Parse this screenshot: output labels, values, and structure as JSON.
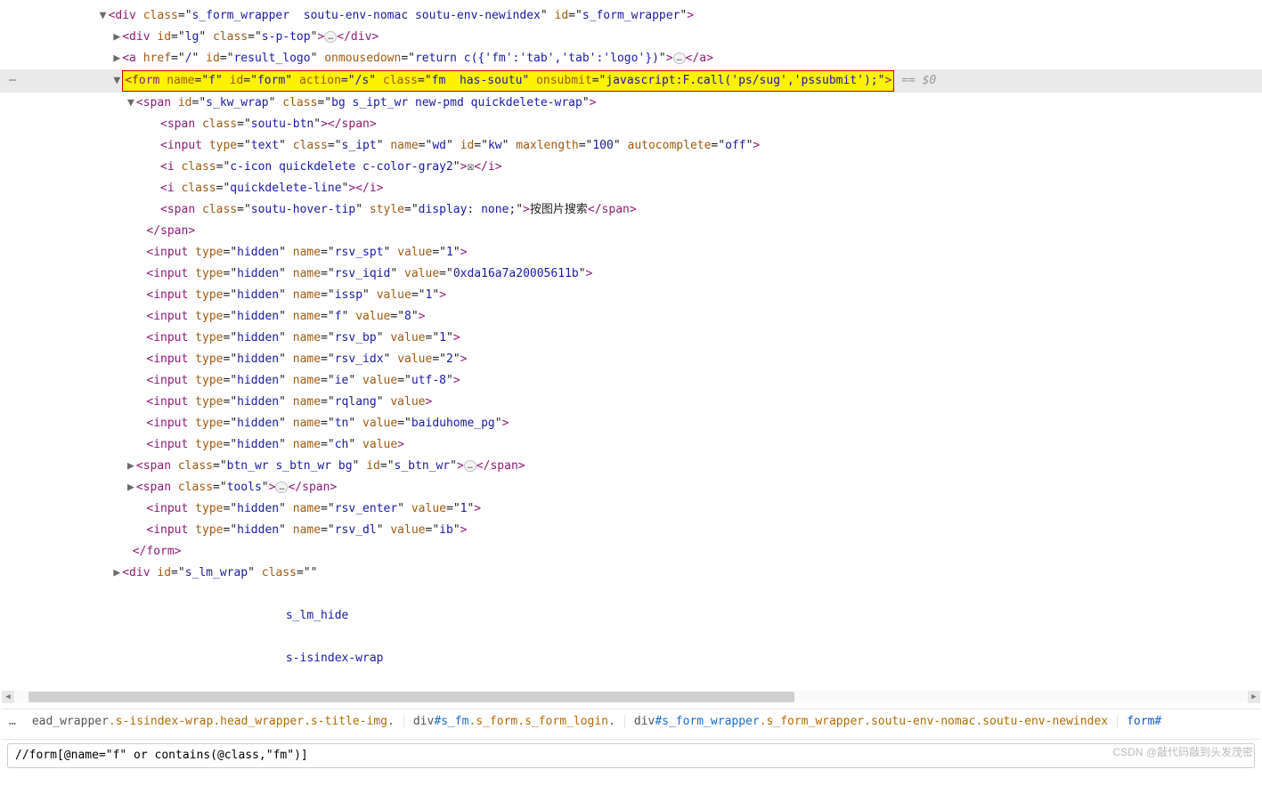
{
  "gutterDots": "…",
  "selectedAfter": " == $0",
  "searchValue": "//form[@name=\"f\" or contains(@class,\"fm\")]",
  "watermark": "CSDN @敲代码敲到头发茂密",
  "crumbMore": "…",
  "crumbsHtml": [
    "ead_wrapper<span class='cclass'>.s-isindex-wrap.head_wrapper.s-title-img</span>.",
    "div<span class='cid'>#s_fm</span><span class='cclass'>.s_form.s_form_login</span>.",
    "div<span class='cid'>#s_form_wrapper</span><span class='cclass'>.s_form_wrapper.soutu-env-nomac.soutu-env-newindex</span>",
    "form<span class='cid'>#</span>"
  ],
  "crumbHighlightIndex": 3,
  "lines": [
    {
      "indent": 112,
      "arrow": "▼",
      "highlight": false,
      "tokens": [
        {
          "t": "tag",
          "s": "<div"
        },
        {
          "t": "sp",
          "s": " "
        },
        {
          "t": "attr",
          "n": "class",
          "v": "s_form_wrapper  soutu-env-nomac soutu-env-newindex"
        },
        {
          "t": "sp",
          "s": " "
        },
        {
          "t": "attr",
          "n": "id",
          "v": "s_form_wrapper"
        },
        {
          "t": "tag",
          "s": ">"
        }
      ]
    },
    {
      "indent": 128,
      "arrow": "▶",
      "tokens": [
        {
          "t": "tag",
          "s": "<div"
        },
        {
          "t": "sp",
          "s": " "
        },
        {
          "t": "attr",
          "n": "id",
          "v": "lg"
        },
        {
          "t": "sp",
          "s": " "
        },
        {
          "t": "attr",
          "n": "class",
          "v": "s-p-top"
        },
        {
          "t": "tag",
          "s": ">"
        },
        {
          "t": "bubble"
        },
        {
          "t": "tag",
          "s": "</div>"
        }
      ]
    },
    {
      "indent": 128,
      "arrow": "▶",
      "tokens": [
        {
          "t": "tag",
          "s": "<a"
        },
        {
          "t": "sp",
          "s": " "
        },
        {
          "t": "attr",
          "n": "href",
          "v": "/"
        },
        {
          "t": "sp",
          "s": " "
        },
        {
          "t": "attr",
          "n": "id",
          "v": "result_logo"
        },
        {
          "t": "sp",
          "s": " "
        },
        {
          "t": "attr",
          "n": "onmousedown",
          "v": "return c({'fm':'tab','tab':'logo'})"
        },
        {
          "t": "tag",
          "s": ">"
        },
        {
          "t": "bubble"
        },
        {
          "t": "tag",
          "s": "</a>"
        }
      ]
    },
    {
      "indent": 128,
      "arrow": "▼",
      "highlight": true,
      "selected": true,
      "tokens": [
        {
          "t": "tag",
          "s": "<form"
        },
        {
          "t": "sp",
          "s": " "
        },
        {
          "t": "attr",
          "n": "name",
          "v": "f"
        },
        {
          "t": "sp",
          "s": " "
        },
        {
          "t": "attr",
          "n": "id",
          "v": "form"
        },
        {
          "t": "sp",
          "s": " "
        },
        {
          "t": "attr",
          "n": "action",
          "v": "/s"
        },
        {
          "t": "sp",
          "s": " "
        },
        {
          "t": "attr",
          "n": "class",
          "v": "fm  has-soutu"
        },
        {
          "t": "sp",
          "s": " "
        },
        {
          "t": "attr",
          "n": "onsubmit",
          "v": "javascript:F.call('ps/sug','pssubmit');"
        },
        {
          "t": "tag",
          "s": ">"
        }
      ]
    },
    {
      "indent": 144,
      "arrow": "▼",
      "tokens": [
        {
          "t": "tag",
          "s": "<span"
        },
        {
          "t": "sp",
          "s": " "
        },
        {
          "t": "attr",
          "n": "id",
          "v": "s_kw_wrap"
        },
        {
          "t": "sp",
          "s": " "
        },
        {
          "t": "attr",
          "n": "class",
          "v": "bg s_ipt_wr new-pmd quickdelete-wrap"
        },
        {
          "t": "tag",
          "s": ">"
        }
      ]
    },
    {
      "indent": 174,
      "tokens": [
        {
          "t": "tag",
          "s": "<span"
        },
        {
          "t": "sp",
          "s": " "
        },
        {
          "t": "attr",
          "n": "class",
          "v": "soutu-btn"
        },
        {
          "t": "tag",
          "s": ">"
        },
        {
          "t": "tag",
          "s": "</span>"
        }
      ]
    },
    {
      "indent": 174,
      "tokens": [
        {
          "t": "tag",
          "s": "<input"
        },
        {
          "t": "sp",
          "s": " "
        },
        {
          "t": "attr",
          "n": "type",
          "v": "text"
        },
        {
          "t": "sp",
          "s": " "
        },
        {
          "t": "attr",
          "n": "class",
          "v": "s_ipt"
        },
        {
          "t": "sp",
          "s": " "
        },
        {
          "t": "attr",
          "n": "name",
          "v": "wd"
        },
        {
          "t": "sp",
          "s": " "
        },
        {
          "t": "attr",
          "n": "id",
          "v": "kw"
        },
        {
          "t": "sp",
          "s": " "
        },
        {
          "t": "attr",
          "n": "maxlength",
          "v": "100"
        },
        {
          "t": "sp",
          "s": " "
        },
        {
          "t": "attr",
          "n": "autocomplete",
          "v": "off"
        },
        {
          "t": "tag",
          "s": ">"
        }
      ]
    },
    {
      "indent": 174,
      "tokens": [
        {
          "t": "tag",
          "s": "<i"
        },
        {
          "t": "sp",
          "s": " "
        },
        {
          "t": "attr",
          "n": "class",
          "v": "c-icon quickdelete c-color-gray2"
        },
        {
          "t": "tag",
          "s": ">"
        },
        {
          "t": "txt",
          "s": "☒"
        },
        {
          "t": "tag",
          "s": "</i>"
        }
      ]
    },
    {
      "indent": 174,
      "tokens": [
        {
          "t": "tag",
          "s": "<i"
        },
        {
          "t": "sp",
          "s": " "
        },
        {
          "t": "attr",
          "n": "class",
          "v": "quickdelete-line"
        },
        {
          "t": "tag",
          "s": ">"
        },
        {
          "t": "tag",
          "s": "</i>"
        }
      ]
    },
    {
      "indent": 174,
      "tokens": [
        {
          "t": "tag",
          "s": "<span"
        },
        {
          "t": "sp",
          "s": " "
        },
        {
          "t": "attr",
          "n": "class",
          "v": "soutu-hover-tip"
        },
        {
          "t": "sp",
          "s": " "
        },
        {
          "t": "attr",
          "n": "style",
          "v": "display: none;"
        },
        {
          "t": "tag",
          "s": ">"
        },
        {
          "t": "txt",
          "s": "按图片搜索"
        },
        {
          "t": "tag",
          "s": "</span>"
        }
      ]
    },
    {
      "indent": 158,
      "tokens": [
        {
          "t": "tag",
          "s": "</span>"
        }
      ]
    },
    {
      "indent": 158,
      "tokens": [
        {
          "t": "tag",
          "s": "<input"
        },
        {
          "t": "sp",
          "s": " "
        },
        {
          "t": "attr",
          "n": "type",
          "v": "hidden"
        },
        {
          "t": "sp",
          "s": " "
        },
        {
          "t": "attr",
          "n": "name",
          "v": "rsv_spt"
        },
        {
          "t": "sp",
          "s": " "
        },
        {
          "t": "attr",
          "n": "value",
          "v": "1"
        },
        {
          "t": "tag",
          "s": ">"
        }
      ]
    },
    {
      "indent": 158,
      "tokens": [
        {
          "t": "tag",
          "s": "<input"
        },
        {
          "t": "sp",
          "s": " "
        },
        {
          "t": "attr",
          "n": "type",
          "v": "hidden"
        },
        {
          "t": "sp",
          "s": " "
        },
        {
          "t": "attr",
          "n": "name",
          "v": "rsv_iqid"
        },
        {
          "t": "sp",
          "s": " "
        },
        {
          "t": "attr",
          "n": "value",
          "v": "0xda16a7a20005611b"
        },
        {
          "t": "tag",
          "s": ">"
        }
      ]
    },
    {
      "indent": 158,
      "tokens": [
        {
          "t": "tag",
          "s": "<input"
        },
        {
          "t": "sp",
          "s": " "
        },
        {
          "t": "attr",
          "n": "type",
          "v": "hidden"
        },
        {
          "t": "sp",
          "s": " "
        },
        {
          "t": "attr",
          "n": "name",
          "v": "issp"
        },
        {
          "t": "sp",
          "s": " "
        },
        {
          "t": "attr",
          "n": "value",
          "v": "1"
        },
        {
          "t": "tag",
          "s": ">"
        }
      ]
    },
    {
      "indent": 158,
      "tokens": [
        {
          "t": "tag",
          "s": "<input"
        },
        {
          "t": "sp",
          "s": " "
        },
        {
          "t": "attr",
          "n": "type",
          "v": "hidden"
        },
        {
          "t": "sp",
          "s": " "
        },
        {
          "t": "attr",
          "n": "name",
          "v": "f"
        },
        {
          "t": "sp",
          "s": " "
        },
        {
          "t": "attr",
          "n": "value",
          "v": "8"
        },
        {
          "t": "tag",
          "s": ">"
        }
      ]
    },
    {
      "indent": 158,
      "tokens": [
        {
          "t": "tag",
          "s": "<input"
        },
        {
          "t": "sp",
          "s": " "
        },
        {
          "t": "attr",
          "n": "type",
          "v": "hidden"
        },
        {
          "t": "sp",
          "s": " "
        },
        {
          "t": "attr",
          "n": "name",
          "v": "rsv_bp"
        },
        {
          "t": "sp",
          "s": " "
        },
        {
          "t": "attr",
          "n": "value",
          "v": "1"
        },
        {
          "t": "tag",
          "s": ">"
        }
      ]
    },
    {
      "indent": 158,
      "tokens": [
        {
          "t": "tag",
          "s": "<input"
        },
        {
          "t": "sp",
          "s": " "
        },
        {
          "t": "attr",
          "n": "type",
          "v": "hidden"
        },
        {
          "t": "sp",
          "s": " "
        },
        {
          "t": "attr",
          "n": "name",
          "v": "rsv_idx"
        },
        {
          "t": "sp",
          "s": " "
        },
        {
          "t": "attr",
          "n": "value",
          "v": "2"
        },
        {
          "t": "tag",
          "s": ">"
        }
      ]
    },
    {
      "indent": 158,
      "tokens": [
        {
          "t": "tag",
          "s": "<input"
        },
        {
          "t": "sp",
          "s": " "
        },
        {
          "t": "attr",
          "n": "type",
          "v": "hidden"
        },
        {
          "t": "sp",
          "s": " "
        },
        {
          "t": "attr",
          "n": "name",
          "v": "ie"
        },
        {
          "t": "sp",
          "s": " "
        },
        {
          "t": "attr",
          "n": "value",
          "v": "utf-8"
        },
        {
          "t": "tag",
          "s": ">"
        }
      ]
    },
    {
      "indent": 158,
      "tokens": [
        {
          "t": "tag",
          "s": "<input"
        },
        {
          "t": "sp",
          "s": " "
        },
        {
          "t": "attr",
          "n": "type",
          "v": "hidden"
        },
        {
          "t": "sp",
          "s": " "
        },
        {
          "t": "attr",
          "n": "name",
          "v": "rqlang"
        },
        {
          "t": "sp",
          "s": " "
        },
        {
          "t": "attrbare",
          "n": "value"
        },
        {
          "t": "tag",
          "s": ">"
        }
      ]
    },
    {
      "indent": 158,
      "tokens": [
        {
          "t": "tag",
          "s": "<input"
        },
        {
          "t": "sp",
          "s": " "
        },
        {
          "t": "attr",
          "n": "type",
          "v": "hidden"
        },
        {
          "t": "sp",
          "s": " "
        },
        {
          "t": "attr",
          "n": "name",
          "v": "tn"
        },
        {
          "t": "sp",
          "s": " "
        },
        {
          "t": "attr",
          "n": "value",
          "v": "baiduhome_pg"
        },
        {
          "t": "tag",
          "s": ">"
        }
      ]
    },
    {
      "indent": 158,
      "tokens": [
        {
          "t": "tag",
          "s": "<input"
        },
        {
          "t": "sp",
          "s": " "
        },
        {
          "t": "attr",
          "n": "type",
          "v": "hidden"
        },
        {
          "t": "sp",
          "s": " "
        },
        {
          "t": "attr",
          "n": "name",
          "v": "ch"
        },
        {
          "t": "sp",
          "s": " "
        },
        {
          "t": "attrbare",
          "n": "value"
        },
        {
          "t": "tag",
          "s": ">"
        }
      ]
    },
    {
      "indent": 144,
      "arrow": "▶",
      "tokens": [
        {
          "t": "tag",
          "s": "<span"
        },
        {
          "t": "sp",
          "s": " "
        },
        {
          "t": "attr",
          "n": "class",
          "v": "btn_wr s_btn_wr bg"
        },
        {
          "t": "sp",
          "s": " "
        },
        {
          "t": "attr",
          "n": "id",
          "v": "s_btn_wr"
        },
        {
          "t": "tag",
          "s": ">"
        },
        {
          "t": "bubble"
        },
        {
          "t": "tag",
          "s": "</span>"
        }
      ]
    },
    {
      "indent": 144,
      "arrow": "▶",
      "tokens": [
        {
          "t": "tag",
          "s": "<span"
        },
        {
          "t": "sp",
          "s": " "
        },
        {
          "t": "attr",
          "n": "class",
          "v": "tools"
        },
        {
          "t": "tag",
          "s": ">"
        },
        {
          "t": "bubble"
        },
        {
          "t": "tag",
          "s": "</span>"
        }
      ]
    },
    {
      "indent": 158,
      "tokens": [
        {
          "t": "tag",
          "s": "<input"
        },
        {
          "t": "sp",
          "s": " "
        },
        {
          "t": "attr",
          "n": "type",
          "v": "hidden"
        },
        {
          "t": "sp",
          "s": " "
        },
        {
          "t": "attr",
          "n": "name",
          "v": "rsv_enter"
        },
        {
          "t": "sp",
          "s": " "
        },
        {
          "t": "attr",
          "n": "value",
          "v": "1"
        },
        {
          "t": "tag",
          "s": ">"
        }
      ]
    },
    {
      "indent": 158,
      "tokens": [
        {
          "t": "tag",
          "s": "<input"
        },
        {
          "t": "sp",
          "s": " "
        },
        {
          "t": "attr",
          "n": "type",
          "v": "hidden"
        },
        {
          "t": "sp",
          "s": " "
        },
        {
          "t": "attr",
          "n": "name",
          "v": "rsv_dl"
        },
        {
          "t": "sp",
          "s": " "
        },
        {
          "t": "attr",
          "n": "value",
          "v": "ib"
        },
        {
          "t": "tag",
          "s": ">"
        }
      ]
    },
    {
      "indent": 142,
      "tokens": [
        {
          "t": "tag",
          "s": "</form>"
        }
      ]
    },
    {
      "indent": 128,
      "arrow": "▶",
      "tokens": [
        {
          "t": "tag",
          "s": "<div"
        },
        {
          "t": "sp",
          "s": " "
        },
        {
          "t": "attr",
          "n": "id",
          "v": "s_lm_wrap"
        },
        {
          "t": "sp",
          "s": " "
        },
        {
          "t": "attr",
          "n": "class",
          "v": ""
        }
      ]
    },
    {
      "indent": 0,
      "tokens": []
    },
    {
      "indent": 320,
      "tokens": [
        {
          "t": "attrv",
          "s": "s_lm_hide"
        }
      ]
    },
    {
      "indent": 0,
      "tokens": []
    },
    {
      "indent": 320,
      "tokens": [
        {
          "t": "attrv",
          "s": "s-isindex-wrap"
        }
      ]
    }
  ]
}
